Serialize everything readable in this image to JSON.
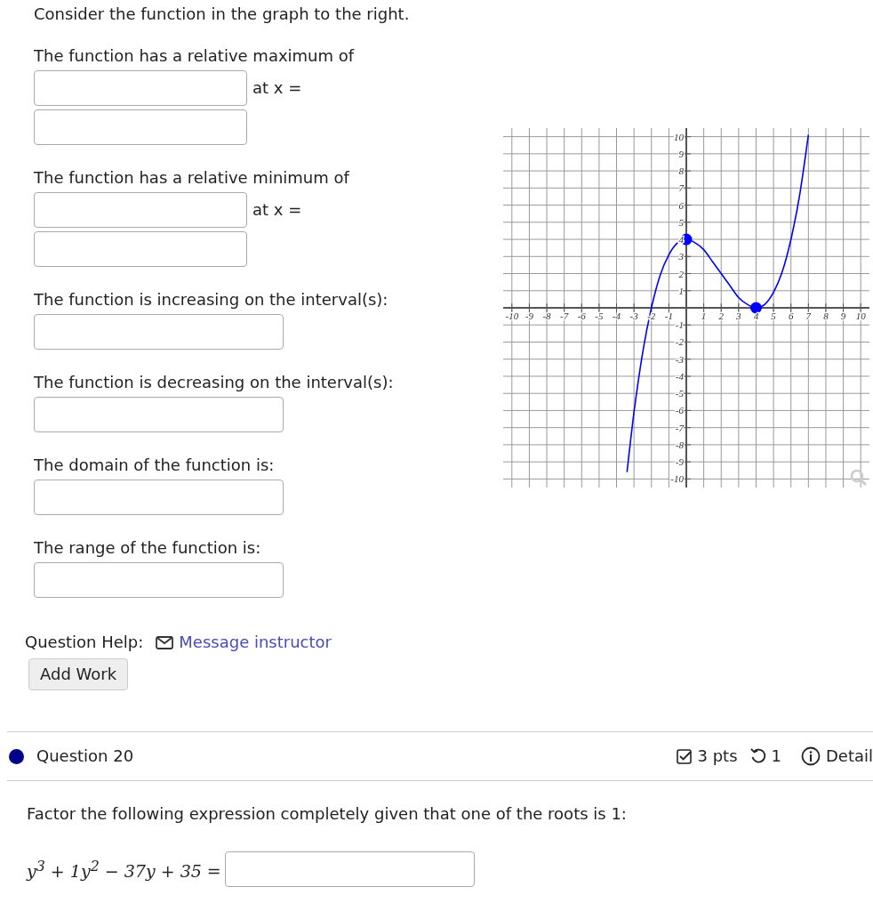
{
  "prompt": "Consider the function in the graph to the right.",
  "questions": [
    {
      "kind": "pair",
      "label": "The function has a relative maximum of",
      "suffix": "at x ="
    },
    {
      "kind": "pair",
      "label": "The function has a relative minimum of",
      "suffix": "at x ="
    },
    {
      "kind": "single",
      "label": "The function is increasing on the interval(s):"
    },
    {
      "kind": "single",
      "label": "The function is decreasing on the interval(s):"
    },
    {
      "kind": "single",
      "label": "The domain of the function is:"
    },
    {
      "kind": "single",
      "label": "The range of the function is:"
    }
  ],
  "graph": {
    "chart_data": {
      "type": "line",
      "grid": true,
      "x": [
        -3.4,
        -3,
        -2.5,
        -2,
        -1.5,
        -1,
        -0.5,
        0,
        0.5,
        1,
        1.5,
        2,
        2.5,
        3,
        3.5,
        4,
        4.5,
        5,
        5.5,
        6,
        6.5,
        7
      ],
      "series": [
        {
          "color": "#0000ff",
          "values": [
            -9.6,
            -6.1,
            -2.6,
            0,
            1.9,
            3.1,
            3.8,
            4,
            3.8,
            3.4,
            2.7,
            2,
            1.3,
            0.6,
            0.2,
            0,
            0.2,
            0.9,
            2.1,
            4,
            6.6,
            10.1
          ]
        }
      ],
      "xlim": [
        -10.5,
        10.5
      ],
      "ylim": [
        -10.5,
        10.5
      ],
      "xticks": [
        -10,
        -9,
        -8,
        -7,
        -6,
        -5,
        -4,
        -3,
        -2,
        -1,
        1,
        2,
        3,
        4,
        5,
        6,
        7,
        8,
        9,
        10
      ],
      "yticks": [
        -10,
        -9,
        -8,
        -7,
        -6,
        -5,
        -4,
        -3,
        -2,
        -1,
        1,
        2,
        3,
        4,
        5,
        6,
        7,
        8,
        9,
        10
      ]
    }
  },
  "help": {
    "label": "Question Help:",
    "link": "Message instructor",
    "button": "Add Work"
  },
  "next_question": {
    "title": "Question 20",
    "color": "#00008b",
    "points": "3 pts",
    "retries": "1",
    "details": "Detail",
    "prompt": "Factor the following expression completely given that one of the roots is 1:",
    "equation": "y$^{3}$ + 1y$^{2}$ − 37y + 35 ="
  }
}
